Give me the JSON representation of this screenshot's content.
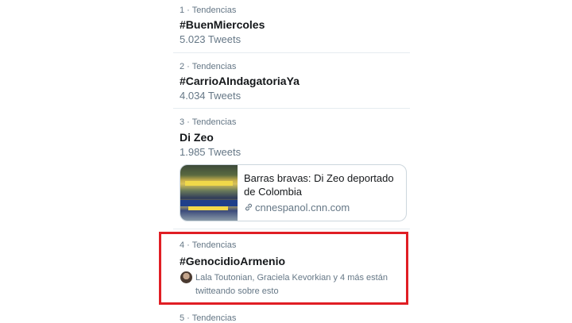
{
  "trends": [
    {
      "meta": "1 · Tendencias",
      "name": "#BuenMiercoles",
      "count": "5.023 Tweets"
    },
    {
      "meta": "2 · Tendencias",
      "name": "#CarrioAIndagatoriaYa",
      "count": "4.034 Tweets"
    },
    {
      "meta": "3 · Tendencias",
      "name": "Di Zeo",
      "count": "1.985 Tweets",
      "card": {
        "title": "Barras bravas: Di Zeo deportado de Colombia",
        "domain": "cnnespanol.cnn.com",
        "icon": "link-icon"
      }
    },
    {
      "meta": "4 · Tendencias",
      "name": "#GenocidioArmenio",
      "social": "Lala Toutonian, Graciela Kevorkian y 4 más están twitteando sobre esto"
    },
    {
      "meta": "5 · Tendencias"
    }
  ],
  "highlight_color": "#e01e24"
}
